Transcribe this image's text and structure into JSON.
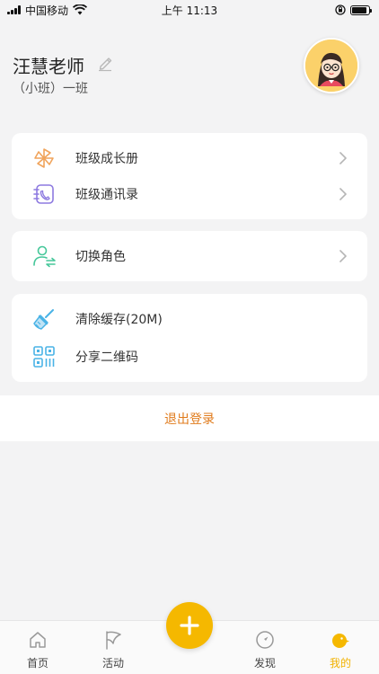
{
  "status_bar": {
    "carrier": "中国移动",
    "time": "上午 11:13"
  },
  "profile": {
    "name": "汪慧老师",
    "class_name": "（小班）一班"
  },
  "menu_groups": [
    {
      "items": [
        {
          "label": "班级成长册",
          "icon": "pinwheel-icon"
        },
        {
          "label": "班级通讯录",
          "icon": "contacts-icon"
        }
      ]
    },
    {
      "items": [
        {
          "label": "切换角色",
          "icon": "switch-role-icon"
        }
      ]
    },
    {
      "items": [
        {
          "label": "清除缓存(20M)",
          "icon": "brush-icon"
        },
        {
          "label": "分享二维码",
          "icon": "qrcode-icon"
        }
      ]
    }
  ],
  "logout_label": "退出登录",
  "tabs": [
    {
      "label": "首页",
      "icon": "home-icon"
    },
    {
      "label": "活动",
      "icon": "flag-icon"
    },
    {
      "label": "发现",
      "icon": "compass-icon"
    },
    {
      "label": "我的",
      "icon": "chick-icon",
      "active": true
    }
  ],
  "colors": {
    "accent": "#f5b800",
    "logout": "#e07b1c",
    "pinwheel": "#f0a45c",
    "contacts": "#8d7ae0",
    "switch_role": "#46c79a",
    "brush": "#4ab3e6",
    "qrcode": "#4ab3e6"
  }
}
